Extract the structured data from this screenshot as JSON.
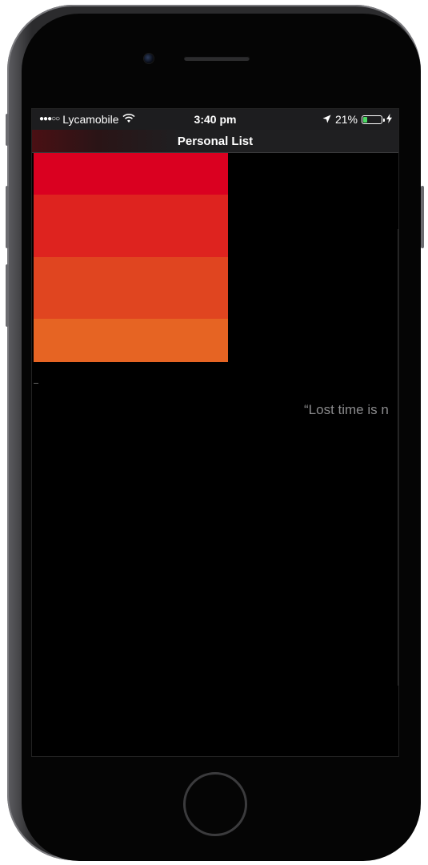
{
  "status_bar": {
    "signal_dots": "●●●○○",
    "carrier": "Lycamobile",
    "time": "3:40 pm",
    "battery_percent": "21%",
    "battery_level": 0.21
  },
  "nav": {
    "title": "Personal List"
  },
  "list": {
    "rows": [
      {
        "color": "#DA0020"
      },
      {
        "color": "#DE231F"
      },
      {
        "color": "#E04520"
      },
      {
        "color": "#E66423"
      }
    ]
  },
  "quote": {
    "text": "“Lost time is n"
  }
}
